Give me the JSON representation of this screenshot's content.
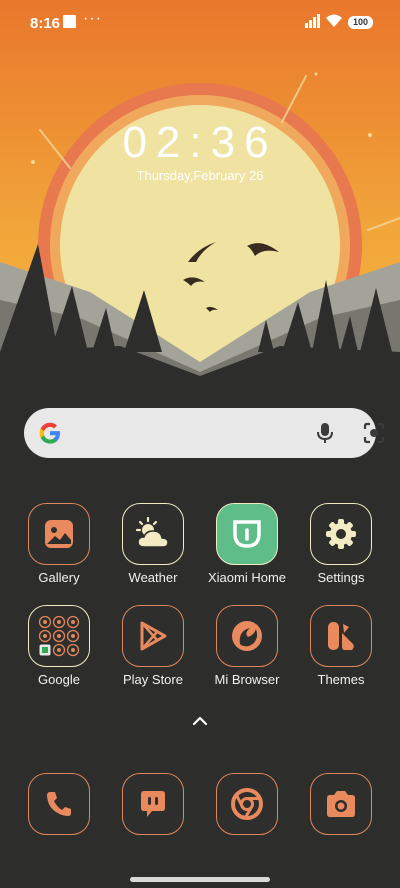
{
  "status_bar": {
    "time": "8:16",
    "battery": "100"
  },
  "lock_widget": {
    "clock": "02:36",
    "date": "Thursday,February 26"
  },
  "search_bar": {
    "icons": [
      "google-g-icon",
      "mic-icon",
      "lens-icon"
    ]
  },
  "apps_row1": [
    {
      "label": "Gallery",
      "icon": "gallery-icon"
    },
    {
      "label": "Weather",
      "icon": "weather-icon"
    },
    {
      "label": "Xiaomi Home",
      "icon": "xiaomi-home-icon"
    },
    {
      "label": "Settings",
      "icon": "gear-icon"
    }
  ],
  "apps_row2": [
    {
      "label": "Google",
      "icon": "google-folder-icon"
    },
    {
      "label": "Play Store",
      "icon": "play-store-icon"
    },
    {
      "label": "Mi Browser",
      "icon": "mi-browser-icon"
    },
    {
      "label": "Themes",
      "icon": "themes-icon"
    }
  ],
  "dock": [
    {
      "icon": "phone-icon"
    },
    {
      "icon": "messages-icon"
    },
    {
      "icon": "chrome-icon"
    },
    {
      "icon": "camera-icon"
    }
  ],
  "colors": {
    "accent": "#e0865c",
    "sky_top": "#e8782e",
    "sky_bottom": "#f3b23a",
    "sun": "#f2e7a0",
    "ground": "#2d2d2b"
  }
}
